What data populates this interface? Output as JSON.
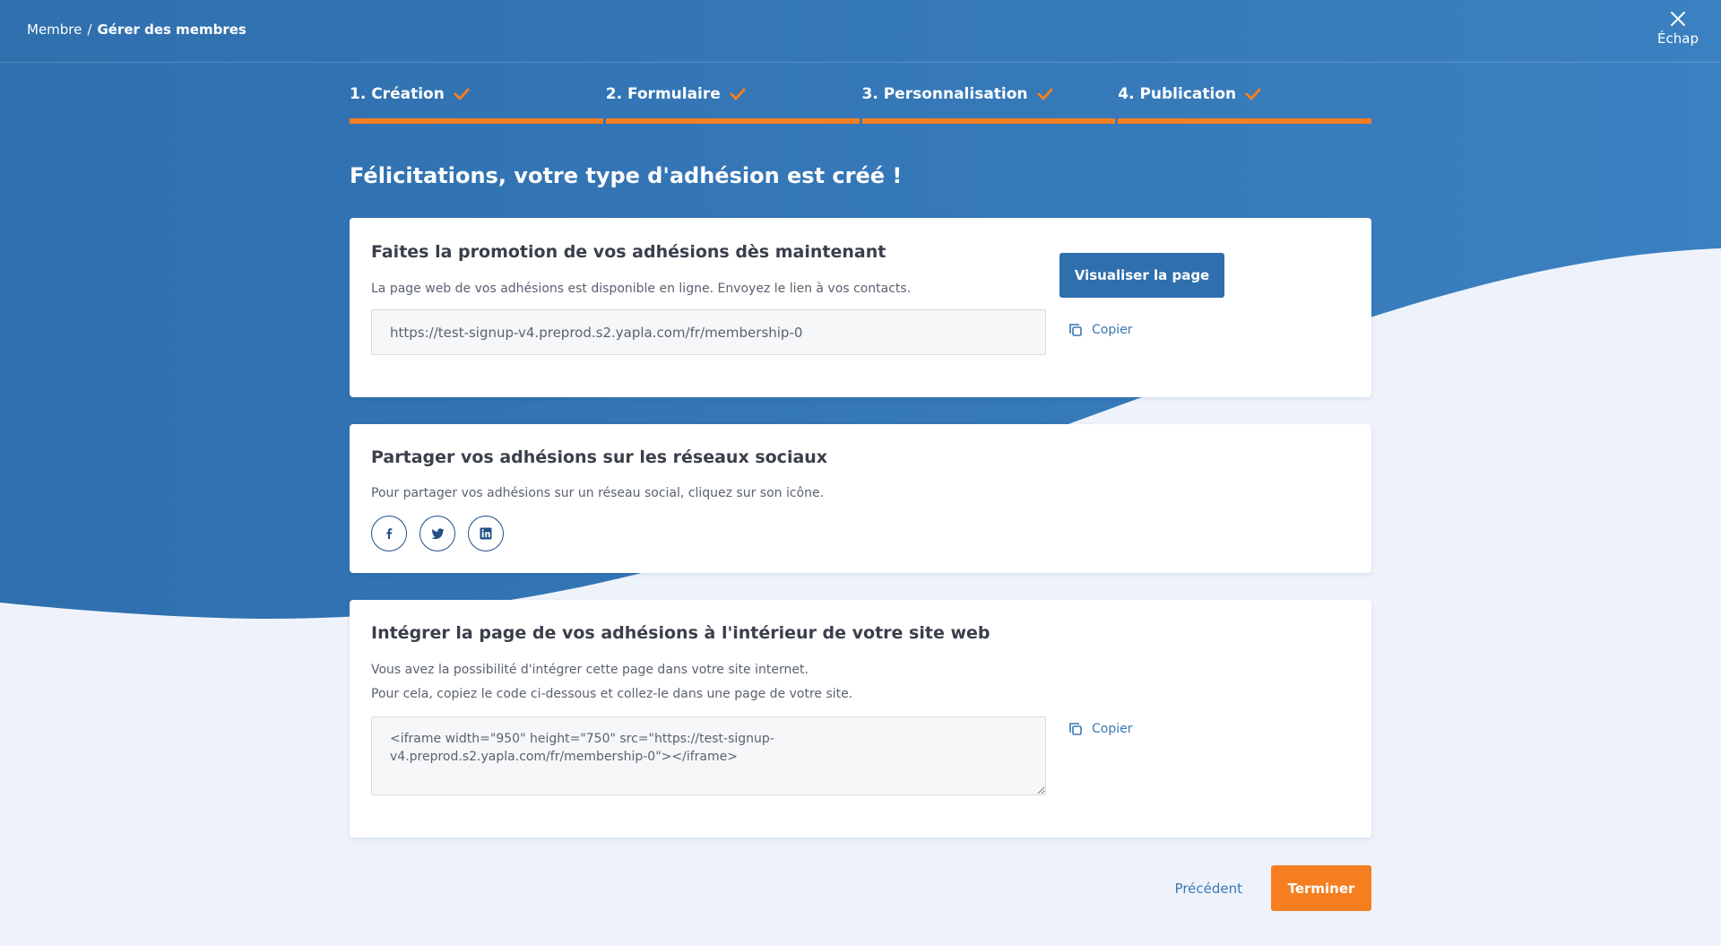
{
  "breadcrumb": {
    "parent": "Membre",
    "separator": "/",
    "current": "Gérer des membres"
  },
  "escape_label": "Échap",
  "steps": [
    {
      "label": "1. Création",
      "done": true
    },
    {
      "label": "2. Formulaire",
      "done": true
    },
    {
      "label": "3. Personnalisation",
      "done": true
    },
    {
      "label": "4. Publication",
      "done": true
    }
  ],
  "heading": "Félicitations, votre type d'adhésion est créé !",
  "promo": {
    "title": "Faites la promotion de vos adhésions dès maintenant",
    "description": "La page web de vos adhésions est disponible en ligne. Envoyez le lien à vos contacts.",
    "url": "https://test-signup-v4.preprod.s2.yapla.com/fr/membership-0",
    "view_button": "Visualiser la page",
    "copy_label": "Copier"
  },
  "social": {
    "title": "Partager vos adhésions sur les réseaux sociaux",
    "description": "Pour partager vos adhésions sur un réseau social, cliquez sur son icône.",
    "icons": [
      "facebook-icon",
      "twitter-icon",
      "linkedin-icon"
    ]
  },
  "embed": {
    "title": "Intégrer la page de vos adhésions à l'intérieur de votre site web",
    "line1": "Vous avez la possibilité d'intégrer cette page dans votre site internet.",
    "line2": "Pour cela, copiez le code ci-dessous et collez-le dans une page de votre site.",
    "code": "<iframe width=\"950\" height=\"750\" src=\"https://test-signup-v4.preprod.s2.yapla.com/fr/membership-0\"></iframe>",
    "copy_label": "Copier"
  },
  "footer": {
    "previous": "Précédent",
    "finish": "Terminer"
  },
  "colors": {
    "primary": "#2f6fae",
    "accent": "#f57f20",
    "background": "#eef3fb"
  }
}
